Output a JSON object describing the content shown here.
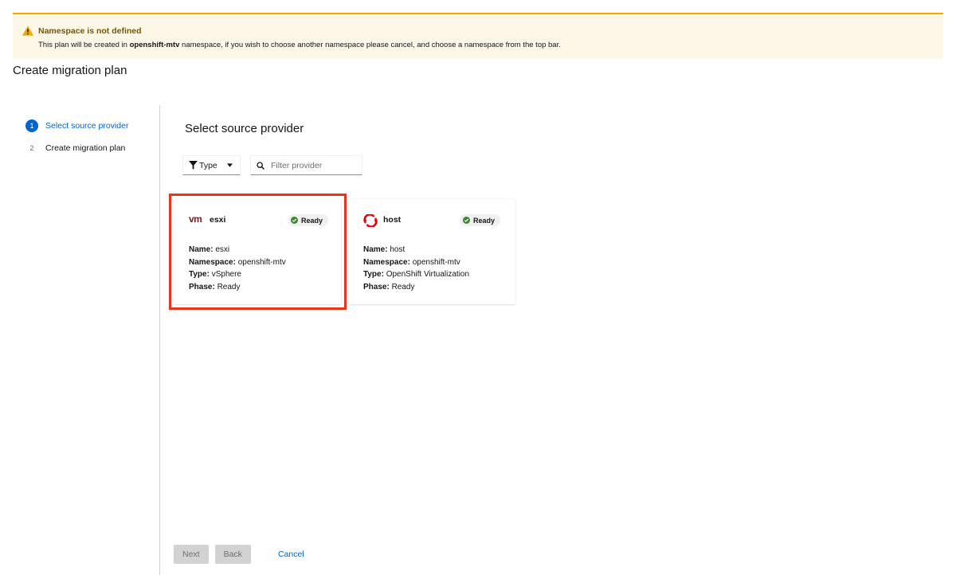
{
  "alert": {
    "title": "Namespace is not defined",
    "body_prefix": "This plan will be created in ",
    "namespace": "openshift-mtv",
    "body_suffix": " namespace, if you wish to choose another namespace please cancel, and choose a namespace from the top bar."
  },
  "page": {
    "title": "Create migration plan"
  },
  "wizard": {
    "steps": [
      {
        "number": "1",
        "label": "Select source provider",
        "active": true
      },
      {
        "number": "2",
        "label": "Create migration plan",
        "active": false
      }
    ]
  },
  "main": {
    "title": "Select source provider",
    "filter": {
      "type_label": "Type",
      "search_placeholder": "Filter provider",
      "search_value": ""
    }
  },
  "providers": [
    {
      "name": "esxi",
      "logo": "vmware-logo",
      "status": "Ready",
      "selected": true,
      "details": {
        "name_label": "Name:",
        "name_value": " esxi",
        "namespace_label": "Namespace:",
        "namespace_value": " openshift-mtv",
        "type_label": "Type:",
        "type_value": " vSphere",
        "phase_label": "Phase:",
        "phase_value": " Ready"
      }
    },
    {
      "name": "host",
      "logo": "openshift-logo",
      "status": "Ready",
      "selected": false,
      "details": {
        "name_label": "Name:",
        "name_value": " host",
        "namespace_label": "Namespace:",
        "namespace_value": " openshift-mtv",
        "type_label": "Type:",
        "type_value": " OpenShift Virtualization",
        "phase_label": "Phase:",
        "phase_value": " Ready"
      }
    }
  ],
  "footer": {
    "next_label": "Next",
    "back_label": "Back",
    "cancel_label": "Cancel"
  },
  "colors": {
    "accent": "#0066cc",
    "warning": "#f0ab00",
    "selection": "#e8361e",
    "success": "#3e8635"
  }
}
